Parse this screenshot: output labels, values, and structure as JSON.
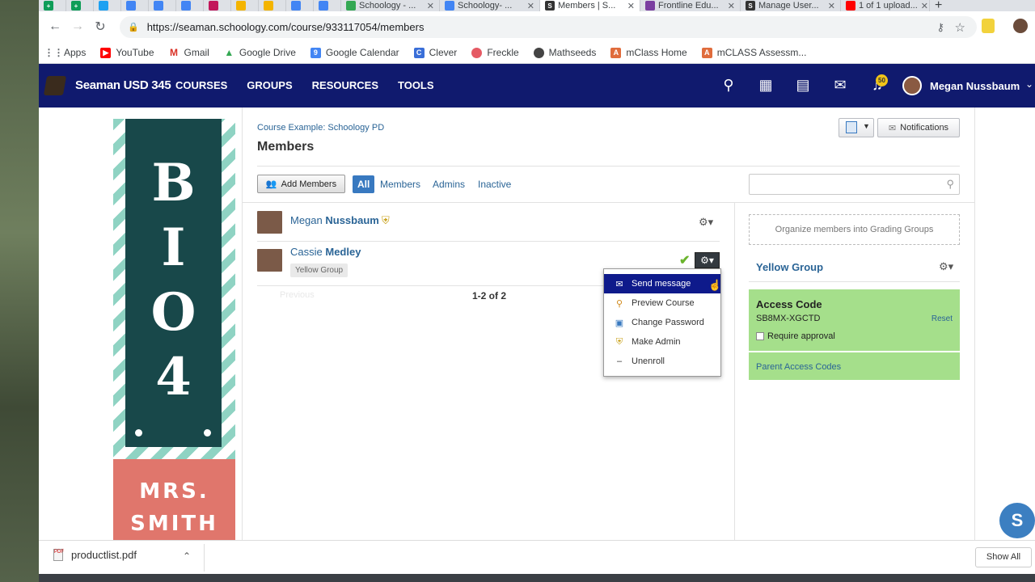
{
  "browser": {
    "tabs": [
      {
        "title": "",
        "icon": "sheets-icon",
        "color": "#0f9d58"
      },
      {
        "title": "",
        "icon": "sheets-icon",
        "color": "#0f9d58"
      },
      {
        "title": "",
        "icon": "twitter-icon",
        "color": "#1da1f2"
      },
      {
        "title": "",
        "icon": "docs-icon",
        "color": "#4285f4"
      },
      {
        "title": "",
        "icon": "docs-icon",
        "color": "#4285f4"
      },
      {
        "title": "",
        "icon": "docs-icon",
        "color": "#4285f4"
      },
      {
        "title": "",
        "icon": "app-icon",
        "color": "#c2185b"
      },
      {
        "title": "",
        "icon": "slides-icon",
        "color": "#f4b400"
      },
      {
        "title": "",
        "icon": "slides-icon",
        "color": "#f4b400"
      },
      {
        "title": "",
        "icon": "docs-icon",
        "color": "#4285f4"
      },
      {
        "title": "",
        "icon": "docs-icon",
        "color": "#4285f4"
      },
      {
        "title": "Schoology - ...",
        "icon": "drive-icon",
        "color": "#34a853"
      },
      {
        "title": "Schoology- ...",
        "icon": "docs-icon",
        "color": "#4285f4"
      },
      {
        "title": "Members | S...",
        "icon": "schoology-icon",
        "color": "#333333"
      },
      {
        "title": "Frontline Edu...",
        "icon": "frontline-icon",
        "color": "#7b3fa0"
      },
      {
        "title": "Manage User...",
        "icon": "schoology-icon",
        "color": "#333333"
      },
      {
        "title": "1 of 1 upload...",
        "icon": "youtube-icon",
        "color": "#ff0000"
      }
    ],
    "url": "https://seaman.schoology.com/course/933117054/members",
    "bookmarks": [
      {
        "label": "Apps",
        "icon": "apps-grid-icon",
        "color": "#5f6368"
      },
      {
        "label": "YouTube",
        "icon": "youtube-icon",
        "color": "#ff0000"
      },
      {
        "label": "Gmail",
        "icon": "gmail-icon",
        "color": "#d93025"
      },
      {
        "label": "Google Drive",
        "icon": "drive-icon",
        "color": "#34a853"
      },
      {
        "label": "Google Calendar",
        "icon": "calendar-icon",
        "color": "#4285f4"
      },
      {
        "label": "Clever",
        "icon": "clever-icon",
        "color": "#3a6fd8"
      },
      {
        "label": "Freckle",
        "icon": "freckle-icon",
        "color": "#e55a64"
      },
      {
        "label": "Mathseeds",
        "icon": "globe-icon",
        "color": "#444444"
      },
      {
        "label": "mClass Home",
        "icon": "amplify-icon",
        "color": "#e06c3c"
      },
      {
        "label": "mCLASS Assessm...",
        "icon": "amplify-icon",
        "color": "#e06c3c"
      }
    ]
  },
  "app": {
    "brand": "Seaman USD 345",
    "nav": [
      "COURSES",
      "GROUPS",
      "RESOURCES",
      "TOOLS"
    ],
    "notification_count": "50",
    "user_name": "Megan Nussbaum"
  },
  "course_cover": {
    "letters": [
      "B",
      "I",
      "O",
      "4"
    ],
    "teacher": [
      "MRS.",
      "SMITH"
    ]
  },
  "page": {
    "breadcrumb": "Course Example: Schoology PD",
    "title": "Members",
    "notifications_button": "Notifications",
    "add_members_button": "Add Members",
    "filters": [
      "All",
      "Members",
      "Admins",
      "Inactive"
    ],
    "search_placeholder": ""
  },
  "members": [
    {
      "first": "Megan",
      "last": "Nussbaum",
      "admin": true,
      "group": ""
    },
    {
      "first": "Cassie",
      "last": "Medley",
      "admin": false,
      "group": "Yellow Group"
    }
  ],
  "pager": {
    "previous": "Previous",
    "count": "1-2 of 2"
  },
  "action_menu": [
    {
      "label": "Send message",
      "icon": "envelope-icon"
    },
    {
      "label": "Preview Course",
      "icon": "magnifier-icon"
    },
    {
      "label": "Change Password",
      "icon": "password-icon"
    },
    {
      "label": "Make Admin",
      "icon": "admin-shield-icon"
    },
    {
      "label": "Unenroll",
      "icon": "minus-icon"
    }
  ],
  "sidebar": {
    "organize": "Organize members into Grading Groups",
    "group_name": "Yellow Group",
    "access_code_title": "Access Code",
    "access_code": "SB8MX-XGCTD",
    "reset": "Reset",
    "require_approval": "Require approval",
    "parent_codes": "Parent Access Codes"
  },
  "download": {
    "file": "productlist.pdf",
    "show_all": "Show All"
  },
  "colors": {
    "nav_bg": "#101a6e",
    "link": "#2a6496",
    "access_bg": "#a5df8b",
    "menu_highlight": "#0e1a8b"
  }
}
